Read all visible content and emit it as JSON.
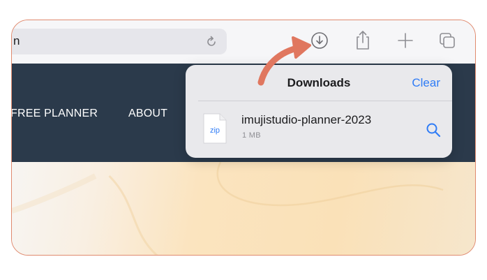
{
  "browser": {
    "address_text": "n",
    "icons": [
      "reload-icon",
      "download-icon",
      "share-icon",
      "new-tab-icon",
      "tabs-icon"
    ]
  },
  "site_nav": {
    "items": [
      "FREE PLANNER",
      "ABOUT"
    ]
  },
  "downloads": {
    "title": "Downloads",
    "clear_label": "Clear",
    "items": [
      {
        "file_type": "zip",
        "name": "imujistudio-planner-2023",
        "size": "1 MB"
      }
    ]
  },
  "colors": {
    "accent": "#2f7cf6",
    "nav_bg": "#2b3a4b",
    "annotation_arrow": "#e0775f",
    "frame_border": "#e08a6e"
  }
}
